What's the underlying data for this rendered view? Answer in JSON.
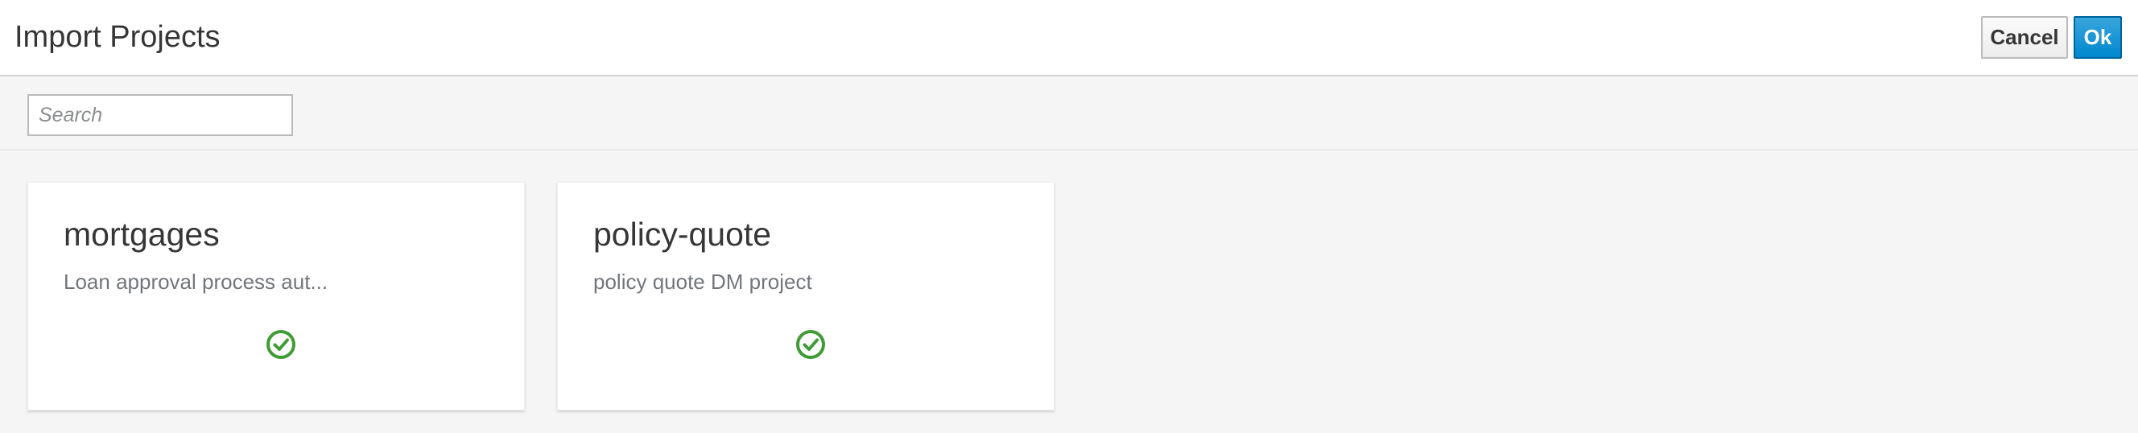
{
  "header": {
    "title": "Import Projects",
    "cancel_label": "Cancel",
    "ok_label": "Ok"
  },
  "search": {
    "placeholder": "Search",
    "value": ""
  },
  "projects": [
    {
      "name": "mortgages",
      "description": "Loan approval process aut...",
      "status_icon": "check-circle-icon"
    },
    {
      "name": "policy-quote",
      "description": "policy quote DM project",
      "status_icon": "check-circle-icon"
    }
  ],
  "colors": {
    "primary": "#0088ce",
    "success": "#3f9c35",
    "page_bg": "#f5f5f5"
  }
}
